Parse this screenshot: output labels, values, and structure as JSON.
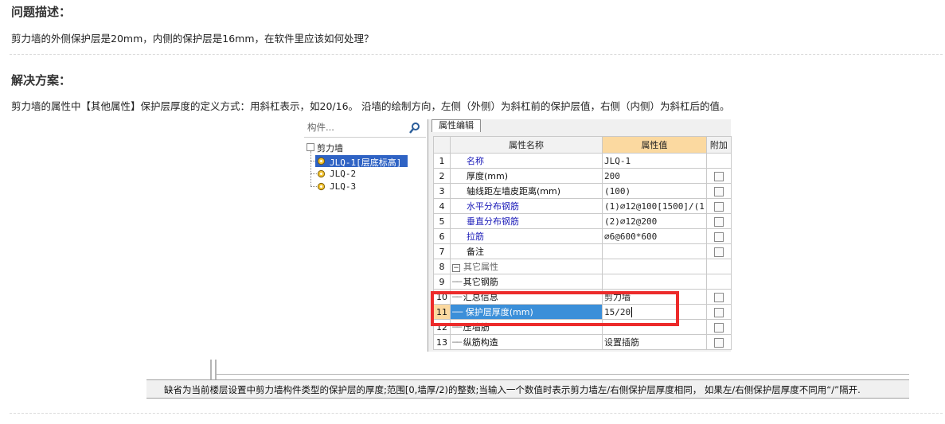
{
  "problem": {
    "heading": "问题描述：",
    "text": "剪力墙的外侧保护层是20mm，内侧的保护层是16mm，在软件里应该如何处理？"
  },
  "solution": {
    "heading": "解决方案：",
    "text": "剪力墙的属性中【其他属性】保护层厚度的定义方式：用斜杠表示，如20/16。 沿墙的绘制方向，左侧（外侧）为斜杠前的保护层值，右侧（内侧）为斜杠后的值。"
  },
  "tree": {
    "search_placeholder": "构件...",
    "root": "剪力墙",
    "items": [
      "JLQ-1[层底标高]",
      "JLQ-2",
      "JLQ-3"
    ]
  },
  "property_editor": {
    "tab": "属性编辑",
    "headers": {
      "name": "属性名称",
      "value": "属性值",
      "extra": "附加"
    },
    "rows": [
      {
        "num": "1",
        "name": "名称",
        "value": "JLQ-1",
        "checkbox": false
      },
      {
        "num": "2",
        "name": "厚度(mm)",
        "value": "200",
        "checkbox": true
      },
      {
        "num": "3",
        "name": "轴线距左墙皮距离(mm)",
        "value": "(100)",
        "checkbox": true
      },
      {
        "num": "4",
        "name": "水平分布钢筋",
        "value": "(1)⌀12@100[1500]/(1",
        "checkbox": true
      },
      {
        "num": "5",
        "name": "垂直分布钢筋",
        "value": "(2)⌀12@200",
        "checkbox": true
      },
      {
        "num": "6",
        "name": "拉筋",
        "value": "⌀6@600*600",
        "checkbox": true
      },
      {
        "num": "7",
        "name": "备注",
        "value": "",
        "checkbox": true
      },
      {
        "num": "8",
        "name": "其它属性",
        "value": "",
        "checkbox": false
      },
      {
        "num": "9",
        "name": "其它钢筋",
        "value": "",
        "checkbox": false
      },
      {
        "num": "10",
        "name": "汇总信息",
        "value": "剪力墙",
        "checkbox": true
      },
      {
        "num": "11",
        "name": "保护层厚度(mm)",
        "value": "15/20",
        "checkbox": true
      },
      {
        "num": "12",
        "name": "压墙筋",
        "value": "",
        "checkbox": true
      },
      {
        "num": "13",
        "name": "纵筋构造",
        "value": "设置插筋",
        "checkbox": true
      }
    ]
  },
  "status_bar": {
    "text": "缺省为当前楼层设置中剪力墙构件类型的保护层的厚度;范围[0,墙厚/2)的整数;当输入一个数值时表示剪力墙左/右侧保护层厚度相同， 如果左/右侧保护层厚度不同用“/”隔开."
  },
  "colors": {
    "highlight_box": "#ec2b2b",
    "selected_row": "#3b8fd9",
    "value_header": "#fbd9a0",
    "link_blue": "#1b1bb8"
  }
}
